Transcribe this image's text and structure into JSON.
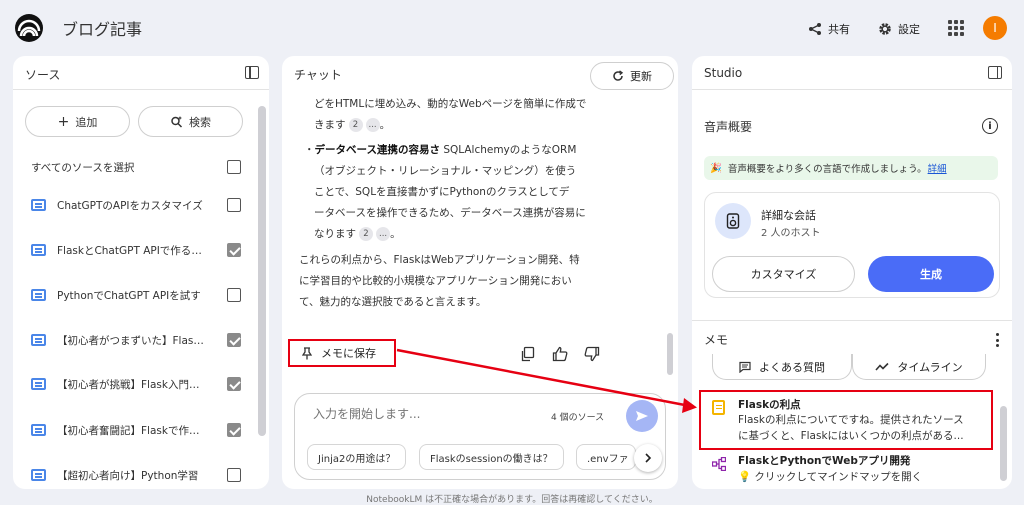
{
  "app": {
    "title": "ブログ記事",
    "avatar_initial": "I"
  },
  "header": {
    "share_label": "共有",
    "settings_label": "設定"
  },
  "sources": {
    "title": "ソース",
    "add_label": "追加",
    "search_label": "検索",
    "select_all_label": "すべてのソースを選択",
    "items": [
      {
        "label": "ChatGPTのAPIをカスタマイズ",
        "checked": false
      },
      {
        "label": "FlaskとChatGPT APIで作るWebアプリ",
        "checked": true
      },
      {
        "label": "PythonでChatGPT APIを試す",
        "checked": false
      },
      {
        "label": "【初心者がつまずいた】Flask開発",
        "checked": true
      },
      {
        "label": "【初心者が挑戦】Flask入門ガイド",
        "checked": true
      },
      {
        "label": "【初心者奮闘記】Flaskで作るアプリ",
        "checked": true
      },
      {
        "label": "【超初心者向け】Python学習",
        "checked": false
      }
    ]
  },
  "chat": {
    "title": "チャット",
    "refresh_label": "更新",
    "line1": "どをHTMLに埋め込み、動的なWebページを簡単に作成で",
    "line2": "きます",
    "cite_a": "2",
    "cite_more": "...",
    "period": "。",
    "bullet_title": "データベース連携の容易さ",
    "bullet_line1": " SQLAlchemyのようなORM",
    "bullet_line2": "（オブジェクト・リレーショナル・マッピング）を使う",
    "bullet_line3": "ことで、SQLを直接書かずにPythonのクラスとしてデ",
    "bullet_line4": "ータベースを操作できるため、データベース連携が容易に",
    "bullet_line5": "なります",
    "cite_b": "2",
    "cite_b_more": "...",
    "para_line1": "これらの利点から、FlaskはWebアプリケーション開発、特",
    "para_line2": "に学習目的や比較的小規模なアプリケーション開発におい",
    "para_line3": "て、魅力的な選択肢であると言えます。",
    "save_memo_label": "メモに保存",
    "input_placeholder": "入力を開始します...",
    "source_count": "4 個のソース",
    "suggestions": [
      "Jinja2の用途は？",
      "Flaskのsessionの働きは？",
      ".envファ"
    ]
  },
  "studio": {
    "title": "Studio",
    "audio_title": "音声概要",
    "banner_text": "音声概要をより多くの言語で作成しましょう。",
    "banner_link": "詳細",
    "card_title": "詳細な会話",
    "card_sub": "2 人のホスト",
    "customize_label": "カスタマイズ",
    "generate_label": "生成",
    "memo_title": "メモ",
    "faq_label": "よくある質問",
    "timeline_label": "タイムライン",
    "note_title": "Flaskの利点",
    "note_body_line1": "Flaskの利点についてですね。提供されたソース",
    "note_body_line2": "に基づくと、Flaskにはいくつかの利点がある...",
    "mindmap_title": "FlaskとPythonでWebアプリ開発",
    "mindmap_sub": "クリックしてマインドマップを開く"
  },
  "footer": {
    "text": "NotebookLM は不正確な場合があります。回答は再確認してください。"
  },
  "colors": {
    "accent": "#4a6cf7",
    "highlight": "#e60012",
    "background": "#eef0f6"
  }
}
